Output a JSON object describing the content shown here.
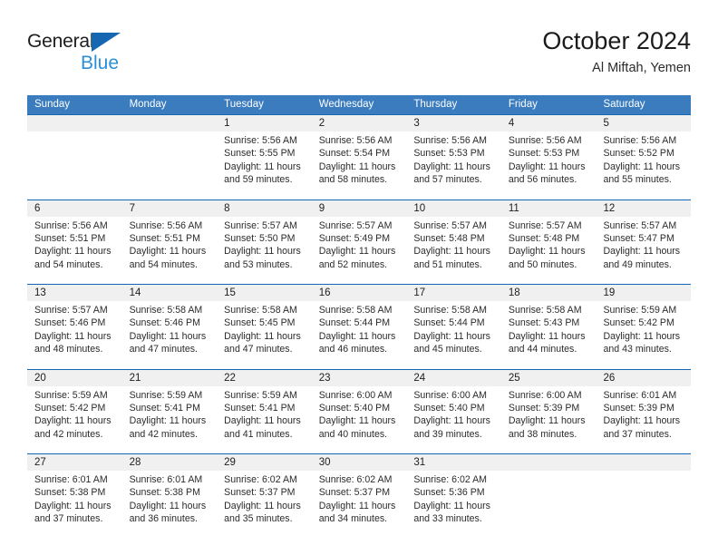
{
  "brand": {
    "name_top": "General",
    "name_bottom": "Blue",
    "triangle_icon": "triangle-logo-icon",
    "accent_color": "#1667b2",
    "secondary_color": "#2a8fd8"
  },
  "header": {
    "title": "October 2024",
    "subtitle": "Al Miftah, Yemen"
  },
  "colors": {
    "weekday_header_bg": "#3a7cbe",
    "week_divider": "#1667b2",
    "date_strip_bg": "#f0f0f0",
    "text": "#2b2b2b"
  },
  "weekdays": [
    "Sunday",
    "Monday",
    "Tuesday",
    "Wednesday",
    "Thursday",
    "Friday",
    "Saturday"
  ],
  "weeks": [
    {
      "days": [
        {
          "num": "",
          "sunrise": "",
          "sunset": "",
          "daylight": "",
          "empty": true
        },
        {
          "num": "",
          "sunrise": "",
          "sunset": "",
          "daylight": "",
          "empty": true
        },
        {
          "num": "1",
          "sunrise": "Sunrise: 5:56 AM",
          "sunset": "Sunset: 5:55 PM",
          "daylight": "Daylight: 11 hours and 59 minutes."
        },
        {
          "num": "2",
          "sunrise": "Sunrise: 5:56 AM",
          "sunset": "Sunset: 5:54 PM",
          "daylight": "Daylight: 11 hours and 58 minutes."
        },
        {
          "num": "3",
          "sunrise": "Sunrise: 5:56 AM",
          "sunset": "Sunset: 5:53 PM",
          "daylight": "Daylight: 11 hours and 57 minutes."
        },
        {
          "num": "4",
          "sunrise": "Sunrise: 5:56 AM",
          "sunset": "Sunset: 5:53 PM",
          "daylight": "Daylight: 11 hours and 56 minutes."
        },
        {
          "num": "5",
          "sunrise": "Sunrise: 5:56 AM",
          "sunset": "Sunset: 5:52 PM",
          "daylight": "Daylight: 11 hours and 55 minutes."
        }
      ]
    },
    {
      "days": [
        {
          "num": "6",
          "sunrise": "Sunrise: 5:56 AM",
          "sunset": "Sunset: 5:51 PM",
          "daylight": "Daylight: 11 hours and 54 minutes."
        },
        {
          "num": "7",
          "sunrise": "Sunrise: 5:56 AM",
          "sunset": "Sunset: 5:51 PM",
          "daylight": "Daylight: 11 hours and 54 minutes."
        },
        {
          "num": "8",
          "sunrise": "Sunrise: 5:57 AM",
          "sunset": "Sunset: 5:50 PM",
          "daylight": "Daylight: 11 hours and 53 minutes."
        },
        {
          "num": "9",
          "sunrise": "Sunrise: 5:57 AM",
          "sunset": "Sunset: 5:49 PM",
          "daylight": "Daylight: 11 hours and 52 minutes."
        },
        {
          "num": "10",
          "sunrise": "Sunrise: 5:57 AM",
          "sunset": "Sunset: 5:48 PM",
          "daylight": "Daylight: 11 hours and 51 minutes."
        },
        {
          "num": "11",
          "sunrise": "Sunrise: 5:57 AM",
          "sunset": "Sunset: 5:48 PM",
          "daylight": "Daylight: 11 hours and 50 minutes."
        },
        {
          "num": "12",
          "sunrise": "Sunrise: 5:57 AM",
          "sunset": "Sunset: 5:47 PM",
          "daylight": "Daylight: 11 hours and 49 minutes."
        }
      ]
    },
    {
      "days": [
        {
          "num": "13",
          "sunrise": "Sunrise: 5:57 AM",
          "sunset": "Sunset: 5:46 PM",
          "daylight": "Daylight: 11 hours and 48 minutes."
        },
        {
          "num": "14",
          "sunrise": "Sunrise: 5:58 AM",
          "sunset": "Sunset: 5:46 PM",
          "daylight": "Daylight: 11 hours and 47 minutes."
        },
        {
          "num": "15",
          "sunrise": "Sunrise: 5:58 AM",
          "sunset": "Sunset: 5:45 PM",
          "daylight": "Daylight: 11 hours and 47 minutes."
        },
        {
          "num": "16",
          "sunrise": "Sunrise: 5:58 AM",
          "sunset": "Sunset: 5:44 PM",
          "daylight": "Daylight: 11 hours and 46 minutes."
        },
        {
          "num": "17",
          "sunrise": "Sunrise: 5:58 AM",
          "sunset": "Sunset: 5:44 PM",
          "daylight": "Daylight: 11 hours and 45 minutes."
        },
        {
          "num": "18",
          "sunrise": "Sunrise: 5:58 AM",
          "sunset": "Sunset: 5:43 PM",
          "daylight": "Daylight: 11 hours and 44 minutes."
        },
        {
          "num": "19",
          "sunrise": "Sunrise: 5:59 AM",
          "sunset": "Sunset: 5:42 PM",
          "daylight": "Daylight: 11 hours and 43 minutes."
        }
      ]
    },
    {
      "days": [
        {
          "num": "20",
          "sunrise": "Sunrise: 5:59 AM",
          "sunset": "Sunset: 5:42 PM",
          "daylight": "Daylight: 11 hours and 42 minutes."
        },
        {
          "num": "21",
          "sunrise": "Sunrise: 5:59 AM",
          "sunset": "Sunset: 5:41 PM",
          "daylight": "Daylight: 11 hours and 42 minutes."
        },
        {
          "num": "22",
          "sunrise": "Sunrise: 5:59 AM",
          "sunset": "Sunset: 5:41 PM",
          "daylight": "Daylight: 11 hours and 41 minutes."
        },
        {
          "num": "23",
          "sunrise": "Sunrise: 6:00 AM",
          "sunset": "Sunset: 5:40 PM",
          "daylight": "Daylight: 11 hours and 40 minutes."
        },
        {
          "num": "24",
          "sunrise": "Sunrise: 6:00 AM",
          "sunset": "Sunset: 5:40 PM",
          "daylight": "Daylight: 11 hours and 39 minutes."
        },
        {
          "num": "25",
          "sunrise": "Sunrise: 6:00 AM",
          "sunset": "Sunset: 5:39 PM",
          "daylight": "Daylight: 11 hours and 38 minutes."
        },
        {
          "num": "26",
          "sunrise": "Sunrise: 6:01 AM",
          "sunset": "Sunset: 5:39 PM",
          "daylight": "Daylight: 11 hours and 37 minutes."
        }
      ]
    },
    {
      "days": [
        {
          "num": "27",
          "sunrise": "Sunrise: 6:01 AM",
          "sunset": "Sunset: 5:38 PM",
          "daylight": "Daylight: 11 hours and 37 minutes."
        },
        {
          "num": "28",
          "sunrise": "Sunrise: 6:01 AM",
          "sunset": "Sunset: 5:38 PM",
          "daylight": "Daylight: 11 hours and 36 minutes."
        },
        {
          "num": "29",
          "sunrise": "Sunrise: 6:02 AM",
          "sunset": "Sunset: 5:37 PM",
          "daylight": "Daylight: 11 hours and 35 minutes."
        },
        {
          "num": "30",
          "sunrise": "Sunrise: 6:02 AM",
          "sunset": "Sunset: 5:37 PM",
          "daylight": "Daylight: 11 hours and 34 minutes."
        },
        {
          "num": "31",
          "sunrise": "Sunrise: 6:02 AM",
          "sunset": "Sunset: 5:36 PM",
          "daylight": "Daylight: 11 hours and 33 minutes."
        },
        {
          "num": "",
          "sunrise": "",
          "sunset": "",
          "daylight": "",
          "empty": true
        },
        {
          "num": "",
          "sunrise": "",
          "sunset": "",
          "daylight": "",
          "empty": true
        }
      ]
    }
  ]
}
